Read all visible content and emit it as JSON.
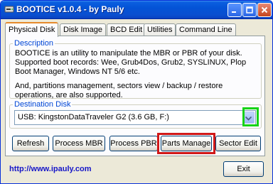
{
  "window": {
    "title": "BOOTICE v1.0.4 - by Pauly",
    "icon": "disk-app-icon",
    "controls": [
      "minimize-icon",
      "maximize-icon",
      "close-icon"
    ]
  },
  "tabs": [
    {
      "label": "Physical Disk",
      "active": true
    },
    {
      "label": "Disk Image",
      "active": false
    },
    {
      "label": "BCD Edit",
      "active": false
    },
    {
      "label": "Utilities",
      "active": false
    },
    {
      "label": "Command Line",
      "active": false
    }
  ],
  "description": {
    "legend": "Description",
    "paragraph1": "BOOTICE is an utility to manipulate the MBR or PBR of your disk. Supported boot records: Wee, Grub4Dos, Grub2, SYSLINUX, Plop Boot Manager, Windows NT 5/6 etc.",
    "paragraph2": "And, partitions management, sectors view / backup / restore operations, are also supported."
  },
  "destination": {
    "legend": "Destination Disk",
    "selected": "USB: KingstonDataTraveler G2 (3.6 GB, F:)"
  },
  "actions": {
    "refresh": "Refresh",
    "process_mbr": "Process MBR",
    "process_pbr": "Process PBR",
    "parts_manage": "Parts Manage",
    "sector_edit": "Sector Edit"
  },
  "footer": {
    "link": "http://www.ipauly.com",
    "exit": "Exit"
  },
  "colors": {
    "titlebar": "#0453d6",
    "highlight_dropdown": "#17d317",
    "highlight_parts_manage": "#d01818",
    "link": "#1515c8"
  }
}
